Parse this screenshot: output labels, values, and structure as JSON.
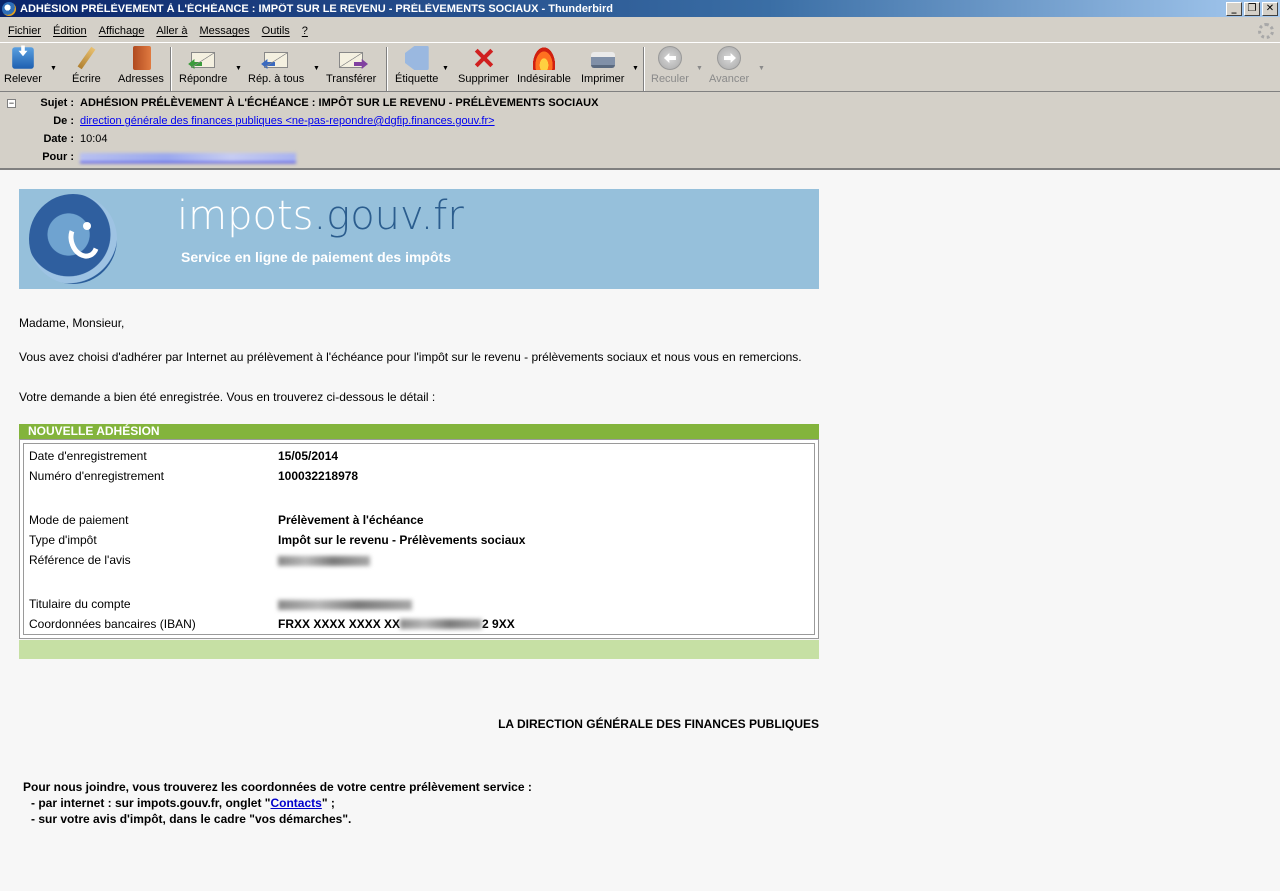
{
  "window": {
    "title": "ADHÉSION PRÉLÈVEMENT À L'ÉCHÉANCE : IMPÔT SUR LE REVENU - PRÉLÈVEMENTS SOCIAUX - Thunderbird",
    "minimize": "_",
    "maximize": "❐",
    "close": "✕"
  },
  "menu": [
    "Fichier",
    "Édition",
    "Affichage",
    "Aller à",
    "Messages",
    "Outils",
    "?"
  ],
  "toolbar": {
    "get": "Relever",
    "write": "Écrire",
    "addressbook": "Adresses",
    "reply": "Répondre",
    "reply_all": "Rép. à tous",
    "forward": "Transférer",
    "tag": "Étiquette",
    "delete": "Supprimer",
    "junk": "Indésirable",
    "print": "Imprimer",
    "back": "Reculer",
    "next": "Avancer",
    "dropdown": "▼"
  },
  "header": {
    "toggle": "−",
    "subject_label": "Sujet :",
    "subject": "ADHÉSION PRÉLÈVEMENT À L'ÉCHÉANCE : IMPÔT SUR LE REVENU - PRÉLÈVEMENTS SOCIAUX",
    "from_label": "De :",
    "from": "direction générale des finances publiques <ne-pas-repondre@dgfip.finances.gouv.fr>",
    "date_label": "Date :",
    "date": "10:04",
    "to_label": "Pour :"
  },
  "banner": {
    "brand_a": "impots",
    "brand_b": ".gouv.fr",
    "tagline": "Service en ligne de paiement des impôts"
  },
  "body": {
    "greeting": "Madame, Monsieur,",
    "para1": "Vous avez choisi d'adhérer par Internet au prélèvement à l'échéance pour l'impôt sur le revenu - prélèvements sociaux et nous vous en remercions.",
    "para2": "Votre demande a bien été enregistrée. Vous en trouverez ci-dessous le détail :",
    "box_title": "NOUVELLE ADHÉSION",
    "rows": {
      "date_label": "Date d'enregistrement",
      "date_value": "15/05/2014",
      "num_label": "Numéro d'enregistrement",
      "num_value": "100032218978",
      "mode_label": "Mode de paiement",
      "mode_value": "Prélèvement à l'échéance",
      "type_label": "Type d'impôt",
      "type_value": "Impôt sur le revenu - Prélèvements sociaux",
      "ref_label": "Référence de l'avis",
      "holder_label": "Titulaire du compte",
      "iban_label": "Coordonnées bancaires (IBAN)",
      "iban_start": "FRXX XXXX XXXX XX",
      "iban_end": "2 9XX"
    },
    "signature": "LA DIRECTION GÉNÉRALE DES FINANCES PUBLIQUES",
    "contact_intro": "Pour nous joindre, vous trouverez les coordonnées de votre centre prélèvement service :",
    "contact_web_a": "- par internet : sur impots.gouv.fr, onglet \"",
    "contact_link": "Contacts",
    "contact_web_b": "\" ;",
    "contact_avis": "- sur votre avis d'impôt, dans le cadre \"vos démarches\"."
  }
}
